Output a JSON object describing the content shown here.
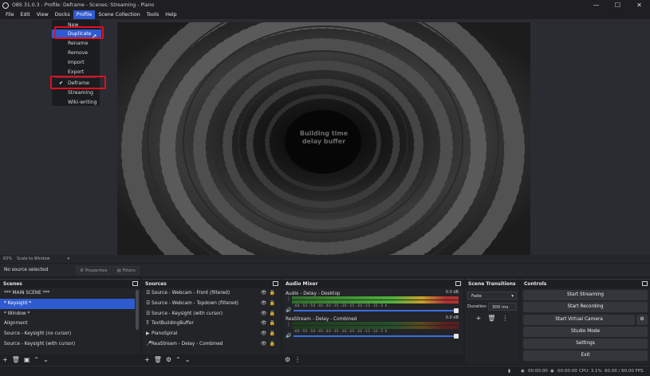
{
  "window": {
    "title": "OBS 31.0.3 - Profile: Deframe - Scenes: Streaming - Piano",
    "minimize": "—",
    "maximize": "☐",
    "close": "✕"
  },
  "menubar": [
    "File",
    "Edit",
    "View",
    "Docks",
    "Profile",
    "Scene Collection",
    "Tools",
    "Help"
  ],
  "profile_menu": {
    "items": [
      "New",
      "Duplicate",
      "Rename",
      "Remove",
      "Import",
      "Export"
    ],
    "profiles": [
      "Deframe",
      "Streaming",
      "Wiki-writing"
    ],
    "checked_profile": "Deframe",
    "highlighted": "Duplicate"
  },
  "preview": {
    "overlay_line1": "Building time",
    "overlay_line2": "delay buffer"
  },
  "zoom": {
    "percent": "63%",
    "mode": "Scale to Window"
  },
  "source_bar": {
    "no_source": "No source selected",
    "properties": "Properties",
    "filters": "Filters"
  },
  "scenes": {
    "title": "Scenes",
    "items": [
      "*** MAIN SCENE ***",
      "* Keysight *",
      "* Window *",
      "Alignment",
      "Source - Keysight (no cursor)",
      "Source - Keysight (with cursor)"
    ],
    "selected_index": 1
  },
  "sources": {
    "title": "Sources",
    "items": [
      {
        "icon": "list",
        "label": "Source - Webcam - Front (filtered)"
      },
      {
        "icon": "list",
        "label": "Source - Webcam - Topdown (filtered)"
      },
      {
        "icon": "list",
        "label": "Source - Keysight (with cursor)"
      },
      {
        "icon": "text",
        "label": "TextBuildingBuffer"
      },
      {
        "icon": "play",
        "label": "PianoSpiral"
      },
      {
        "icon": "mic",
        "label": "ReaStream - Delay - Combined"
      }
    ]
  },
  "audio_mixer": {
    "title": "Audio Mixer",
    "channels": [
      {
        "name": "Audio - Delay - Desktop",
        "db": "0.0 dB",
        "level": 0.95
      },
      {
        "name": "ReaStream - Delay - Combined",
        "db": "0.0 dB",
        "level": 0.0
      }
    ],
    "scale": [
      "-60",
      "-55",
      "-50",
      "-45",
      "-40",
      "-35",
      "-30",
      "-25",
      "-20",
      "-15",
      "-10",
      "-5",
      "0"
    ]
  },
  "scene_transitions": {
    "title": "Scene Transitions",
    "transition": "Fade",
    "duration_label": "Duration",
    "duration_value": "300 ms"
  },
  "controls": {
    "title": "Controls",
    "buttons": [
      "Start Streaming",
      "Start Recording",
      "Start Virtual Camera",
      "Studio Mode",
      "Settings",
      "Exit"
    ]
  },
  "status": {
    "stream_time": "00:00:00",
    "rec_time": "00:00:00",
    "cpu": "CPU: 3.1%",
    "fps": "60.00 / 60.00 FPS"
  },
  "colors": {
    "accent": "#2f5bd0",
    "highlight_box": "#e0101e",
    "background": "#1e1f22"
  }
}
